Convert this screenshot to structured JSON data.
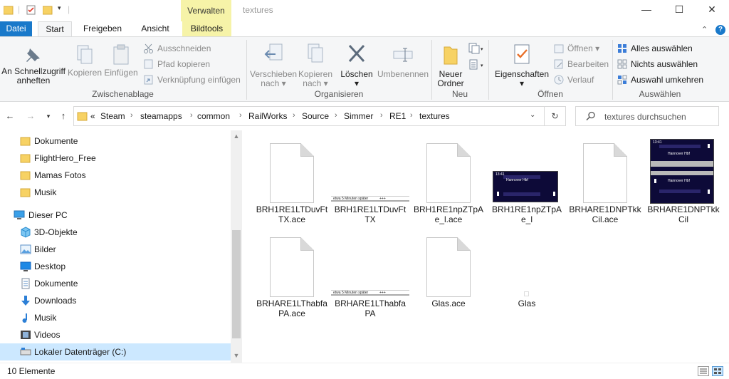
{
  "window": {
    "title": "textures",
    "context_tab": "Verwalten",
    "minimize": "—",
    "maximize": "☐",
    "close": "✕"
  },
  "tabs": [
    "Datei",
    "Start",
    "Freigeben",
    "Ansicht",
    "Bildtools"
  ],
  "ribbon": {
    "clipboard": {
      "label": "Zwischenablage",
      "pin_line1": "An Schnellzugriff",
      "pin_line2": "anheften",
      "copy": "Kopieren",
      "paste": "Einfügen",
      "cut": "Ausschneiden",
      "copy_path": "Pfad kopieren",
      "paste_shortcut": "Verknüpfung einfügen"
    },
    "organize": {
      "label": "Organisieren",
      "move_line1": "Verschieben",
      "move_line2": "nach",
      "copyto_line1": "Kopieren",
      "copyto_line2": "nach",
      "delete": "Löschen",
      "rename": "Umbenennen"
    },
    "new": {
      "label": "Neu",
      "folder_line1": "Neuer",
      "folder_line2": "Ordner"
    },
    "open": {
      "label": "Öffnen",
      "properties": "Eigenschaften",
      "open": "Öffnen",
      "edit": "Bearbeiten",
      "history": "Verlauf"
    },
    "select": {
      "label": "Auswählen",
      "select_all": "Alles auswählen",
      "select_none": "Nichts auswählen",
      "invert": "Auswahl umkehren"
    }
  },
  "address": {
    "overflow": "«",
    "crumbs": [
      "Steam",
      "steamapps",
      "common",
      "RailWorks",
      "Source",
      "Simmer",
      "RE1",
      "textures"
    ]
  },
  "search": {
    "placeholder": "textures durchsuchen"
  },
  "nav": {
    "items": [
      {
        "label": "Dokumente",
        "icon": "folder-icon"
      },
      {
        "label": "FlightHero_Free",
        "icon": "folder-icon"
      },
      {
        "label": "Mamas Fotos",
        "icon": "folder-icon"
      },
      {
        "label": "Musik",
        "icon": "folder-icon"
      },
      {
        "label": "Dieser PC",
        "icon": "pc-icon"
      },
      {
        "label": "3D-Objekte",
        "icon": "cube-icon"
      },
      {
        "label": "Bilder",
        "icon": "pictures-icon"
      },
      {
        "label": "Desktop",
        "icon": "desktop-icon"
      },
      {
        "label": "Dokumente",
        "icon": "documents-icon"
      },
      {
        "label": "Downloads",
        "icon": "download-icon"
      },
      {
        "label": "Musik",
        "icon": "music-icon"
      },
      {
        "label": "Videos",
        "icon": "video-icon"
      },
      {
        "label": "Lokaler Datenträger (C:)",
        "icon": "drive-icon"
      }
    ]
  },
  "files": [
    {
      "name": "BRH1RE1LTDuvFtTX.ace",
      "kind": "doc"
    },
    {
      "name": "BRH1RE1LTDuvFtTX",
      "kind": "strip",
      "text": "etwa 5 Minuten später",
      "mark": "+++"
    },
    {
      "name": "BRH1RE1npZTpAe_l.ace",
      "kind": "doc"
    },
    {
      "name": "BRH1RE1npZTpAe_l",
      "kind": "display-wide",
      "dest": "Hannover Hbf",
      "time": "13:41"
    },
    {
      "name": "BRHARE1DNPTkkCil.ace",
      "kind": "doc"
    },
    {
      "name": "BRHARE1DNPTkkCil",
      "kind": "display-tall",
      "dest": "Hannover Hbf",
      "time": "13:41"
    },
    {
      "name": "BRHARE1LThabfaPA.ace",
      "kind": "doc"
    },
    {
      "name": "BRHARE1LThabfaPA",
      "kind": "strip",
      "text": "etwa 5 Minuten später",
      "mark": "+++"
    },
    {
      "name": "Glas.ace",
      "kind": "doc"
    },
    {
      "name": "Glas",
      "kind": "tiny"
    }
  ],
  "status": {
    "count": "10 Elemente"
  }
}
